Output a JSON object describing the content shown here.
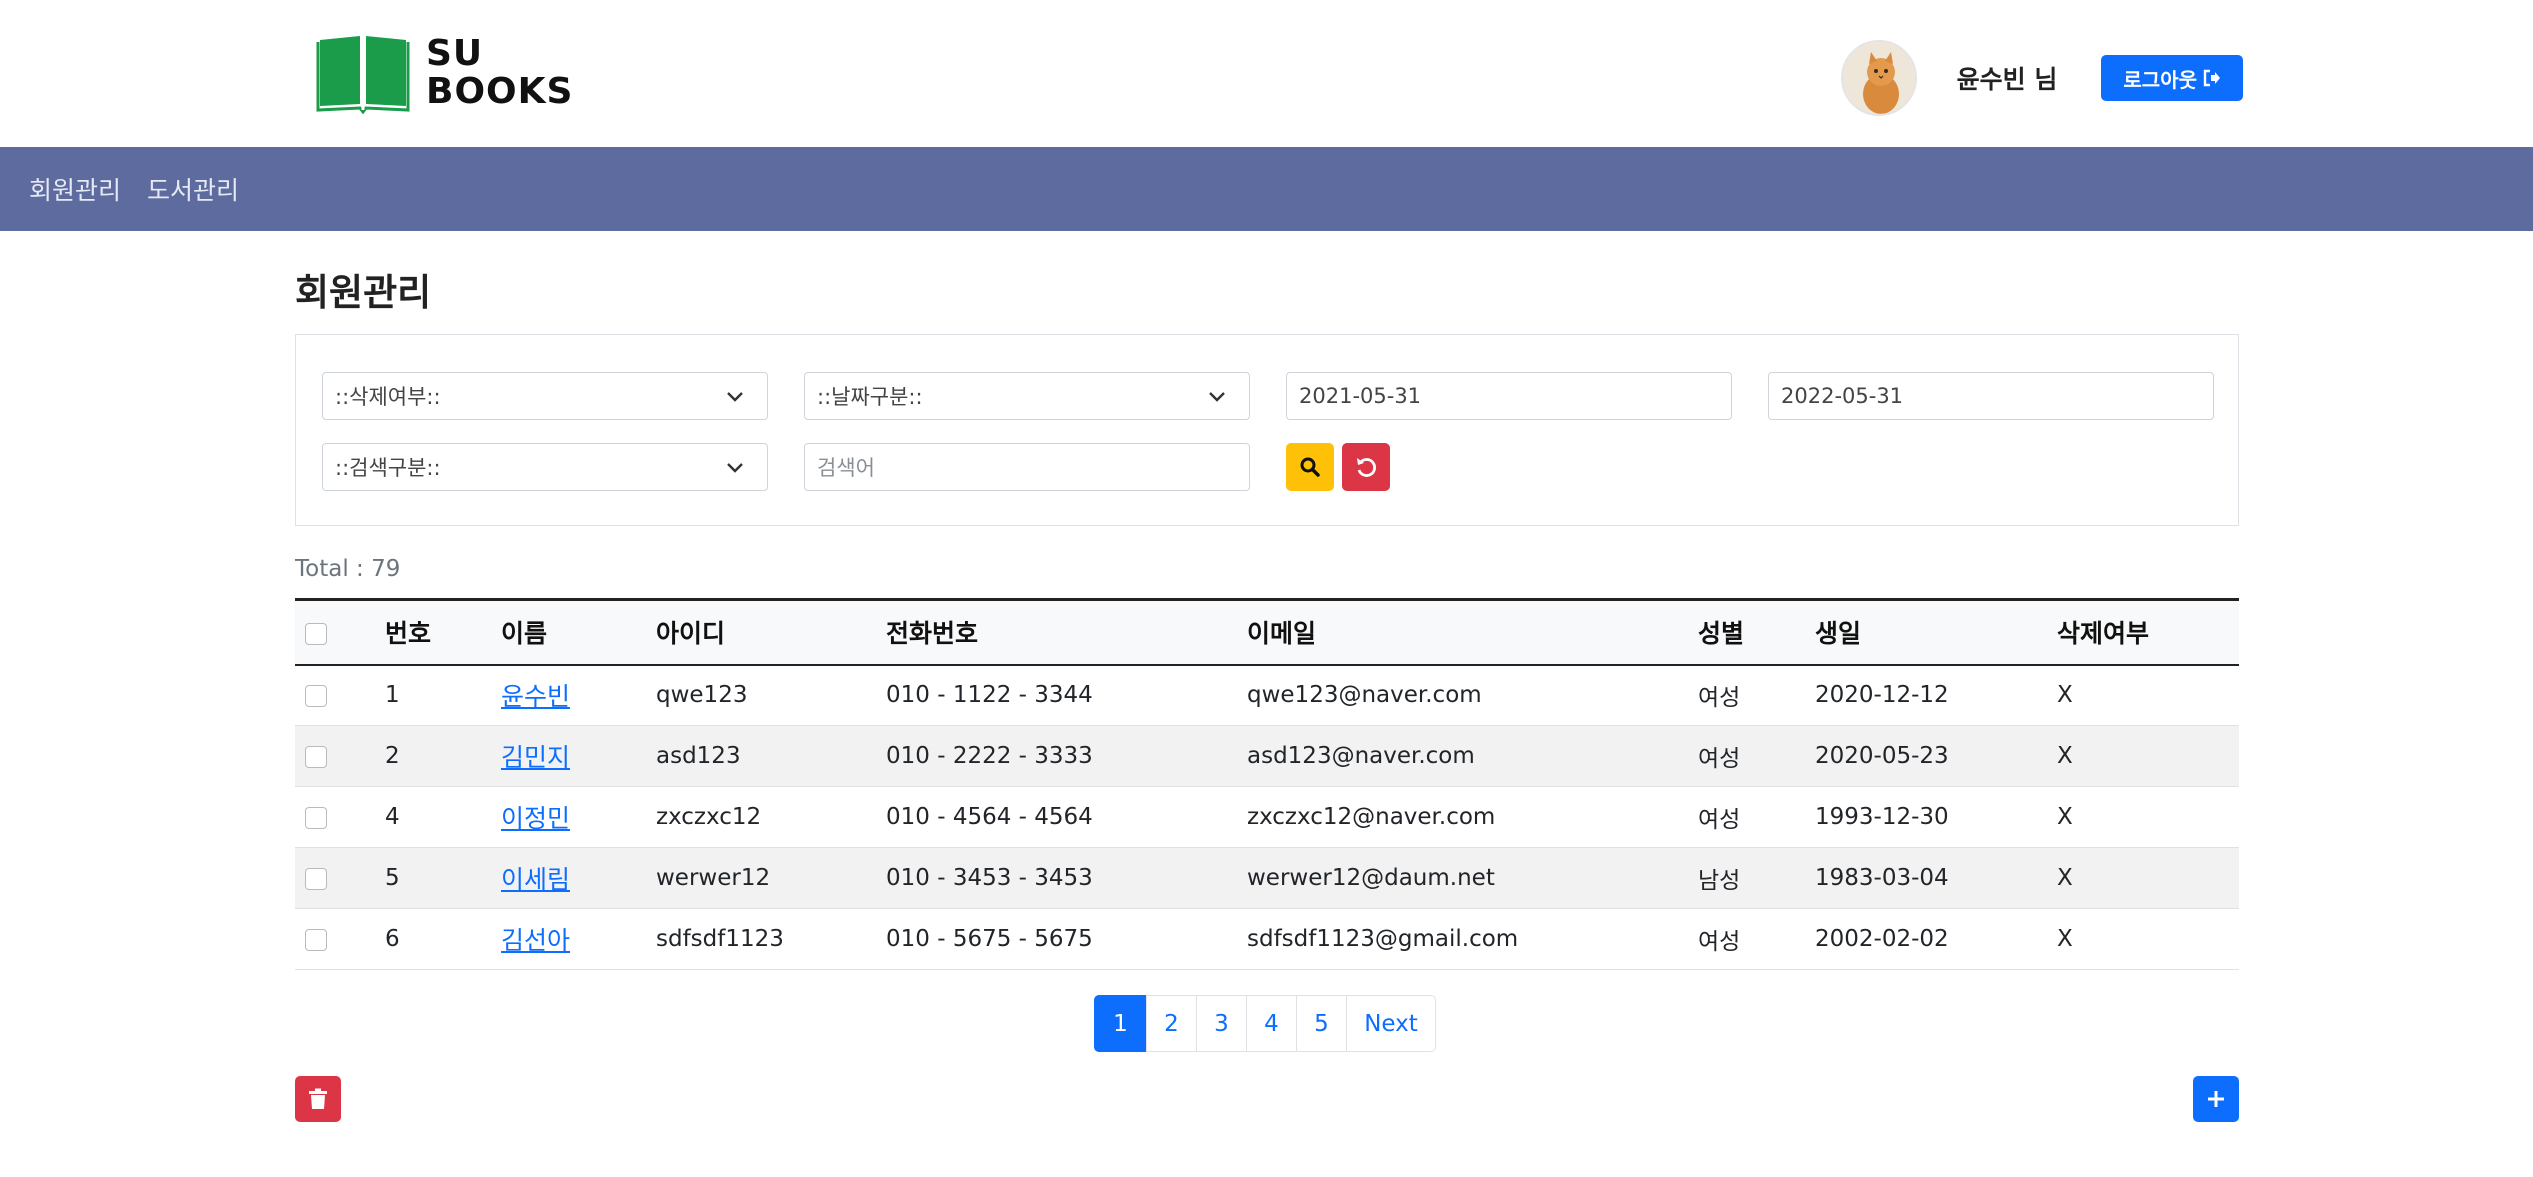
{
  "header": {
    "logo_line1": "SU",
    "logo_line2": "BOOKS",
    "username": "윤수빈 님",
    "logout_label": "로그아웃",
    "brand_color": "#1a9c4b"
  },
  "nav": {
    "items": [
      {
        "label": "회원관리"
      },
      {
        "label": "도서관리"
      }
    ],
    "bg_color": "#5e6b9e"
  },
  "page": {
    "title": "회원관리",
    "total_text": "Total : 79"
  },
  "filters": {
    "delete_status": "::삭제여부::",
    "date_type": "::날짜구분::",
    "start_date": "2021-05-31",
    "end_date": "2022-05-31",
    "search_type": "::검색구분::",
    "keyword_placeholder": "검색어"
  },
  "table": {
    "headers": [
      "번호",
      "이름",
      "아이디",
      "전화번호",
      "이메일",
      "성별",
      "생일",
      "삭제여부"
    ],
    "rows": [
      {
        "no": "1",
        "name": "윤수빈",
        "id": "qwe123",
        "phone": "010 - 1122 - 3344",
        "email": "qwe123@naver.com",
        "gender": "여성",
        "birthday": "2020-12-12",
        "deleted": "X"
      },
      {
        "no": "2",
        "name": "김민지",
        "id": "asd123",
        "phone": "010 - 2222 - 3333",
        "email": "asd123@naver.com",
        "gender": "여성",
        "birthday": "2020-05-23",
        "deleted": "X"
      },
      {
        "no": "4",
        "name": "이정민",
        "id": "zxczxc12",
        "phone": "010 - 4564 - 4564",
        "email": "zxczxc12@naver.com",
        "gender": "여성",
        "birthday": "1993-12-30",
        "deleted": "X"
      },
      {
        "no": "5",
        "name": "이세림",
        "id": "werwer12",
        "phone": "010 - 3453 - 3453",
        "email": "werwer12@daum.net",
        "gender": "남성",
        "birthday": "1983-03-04",
        "deleted": "X"
      },
      {
        "no": "6",
        "name": "김선아",
        "id": "sdfsdf1123",
        "phone": "010 - 5675 - 5675",
        "email": "sdfsdf1123@gmail.com",
        "gender": "여성",
        "birthday": "2002-02-02",
        "deleted": "X"
      }
    ]
  },
  "pagination": {
    "pages": [
      "1",
      "2",
      "3",
      "4",
      "5"
    ],
    "next_label": "Next",
    "active_page": "1"
  },
  "icons": {
    "search": "search-icon",
    "reset": "reset-icon",
    "delete": "trash-icon",
    "add": "plus-icon",
    "logout": "sign-out-icon"
  }
}
